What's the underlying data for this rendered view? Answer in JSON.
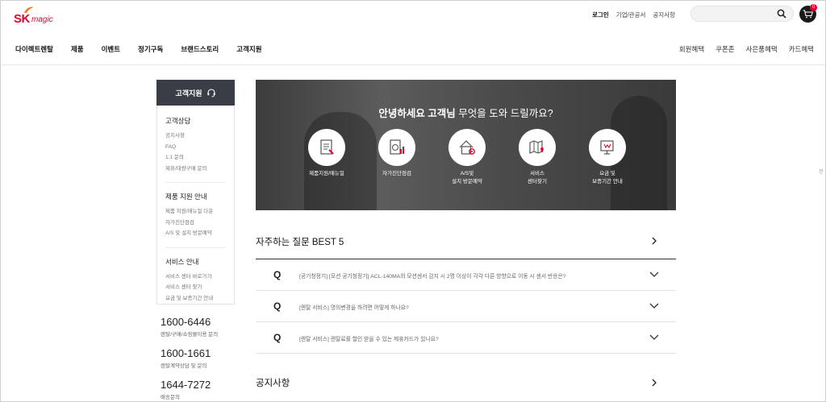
{
  "header": {
    "logo_sk": "SK",
    "logo_magic": "magic",
    "util_links": [
      {
        "label": "로그인",
        "strong": true
      },
      {
        "label": "기업/관공서",
        "strong": false
      },
      {
        "label": "공지사항",
        "strong": false
      }
    ],
    "search_placeholder": "",
    "cart_count": "0",
    "gnb": [
      "다이렉트렌탈",
      "제품",
      "이벤트",
      "정기구독",
      "브랜드스토리",
      "고객지원"
    ],
    "gnb_right": [
      "회원혜택",
      "쿠폰존",
      "사은품혜택",
      "카드혜택"
    ]
  },
  "sidebar": {
    "title": "고객지원",
    "groups": [
      {
        "title": "고객상담",
        "links": [
          "공지사항",
          "FAQ",
          "1:1 문의",
          "제휴/대량구매 문의"
        ]
      },
      {
        "title": "제품 지원 안내",
        "links": [
          "제품 지원/매뉴얼 다운",
          "자가진단점검",
          "A/S 및 설치 방문예약"
        ]
      },
      {
        "title": "서비스 안내",
        "links": [
          "서비스 센터 바로가기",
          "서비스 센터 찾기",
          "요금 및 보증기간 안내"
        ]
      }
    ]
  },
  "phones": [
    {
      "number": "1600-6446",
      "desc": "렌탈/구매/쇼핑몰이용 문의"
    },
    {
      "number": "1600-1661",
      "desc": "렌탈계약상담 및 문의"
    },
    {
      "number": "1644-7272",
      "desc": "배송문의"
    }
  ],
  "hero": {
    "title_bold": "안녕하세요 고객님",
    "title_rest": " 무엇을 도와 드릴까요?",
    "items": [
      {
        "line1": "제품지원/매뉴얼",
        "line2": "",
        "icon": "manual-icon"
      },
      {
        "line1": "자가진단점검",
        "line2": "",
        "icon": "washer-check-icon"
      },
      {
        "line1": "A/S및",
        "line2": "설치 방문예약",
        "icon": "home-service-icon"
      },
      {
        "line1": "서비스",
        "line2": "센터찾기",
        "icon": "map-pin-icon"
      },
      {
        "line1": "요금 및",
        "line2": "보증기간 안내",
        "icon": "warranty-icon"
      }
    ]
  },
  "faq": {
    "title": "자주하는 질문 BEST 5",
    "q_label": "Q",
    "items": [
      "[공기청정기] [모션 공기청정기] ACL-140MA의 모션센서 감지 시 2명 이상이 각각 다른 방향으로 이동 시 센서 반응은?",
      "[렌탈 서비스] 명의변경을 하려면 어떻게 하나요?",
      "[렌탈 서비스] 렌탈료를 할인 받을 수 있는 제휴카드가 있나요?"
    ]
  },
  "notice": {
    "title": "공지사항"
  },
  "stray_text": "전",
  "colors": {
    "brand": "#e6002d",
    "sidebar_head": "#3a3d45"
  }
}
